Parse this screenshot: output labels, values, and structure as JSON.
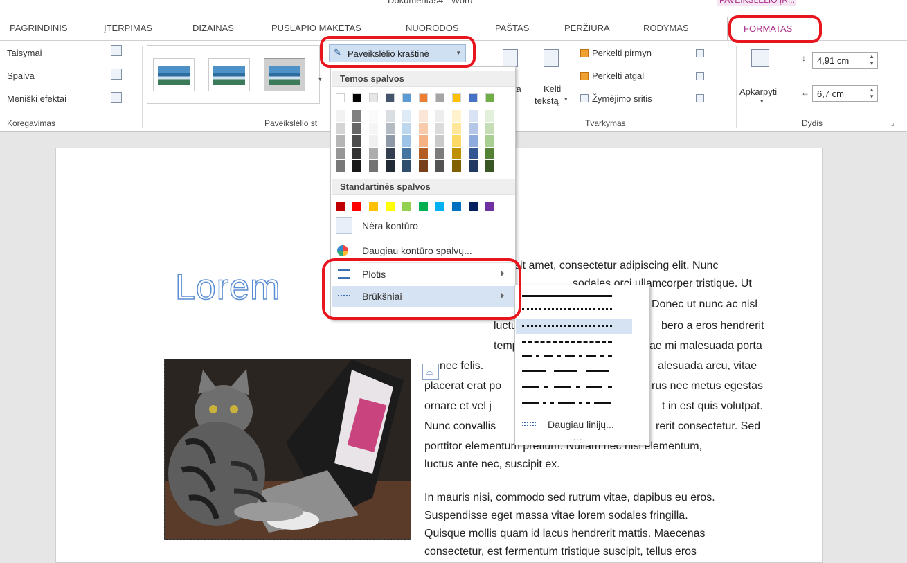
{
  "window": {
    "title": "Dokumentas4 - Word",
    "context_tab_group": "PAVEIKSLĖLIO ĮR..."
  },
  "tabs": [
    "PAGRINDINIS",
    "ĮTERPIMAS",
    "DIZAINAS",
    "PUSLAPIO MAKETAS",
    "NUORODOS",
    "PAŠTAS",
    "PERŽIŪRA",
    "RODYMAS",
    "FORMATAS"
  ],
  "ribbon": {
    "adjust": {
      "corrections": "Taisymai",
      "color": "Spalva",
      "artistic": "Meniški efektai",
      "group": "Koregavimas"
    },
    "picture_styles": {
      "border_button": "Paveikslėlio kraštinė",
      "group_partial": "Paveikslėlio st"
    },
    "arrange": {
      "position_partial": "ta",
      "wrap_line1": "Kelti",
      "wrap_line2": "tekstą",
      "bring_forward": "Perkelti pirmyn",
      "send_backward": "Perkelti atgal",
      "selection_pane": "Žymėjimo sritis",
      "group": "Tvarkymas"
    },
    "size": {
      "crop": "Apkarpyti",
      "height": "4,91 cm",
      "width": "6,7 cm",
      "group": "Dydis"
    }
  },
  "dropdown": {
    "theme_colors_header": "Temos spalvos",
    "standard_colors_header": "Standartinės spalvos",
    "no_outline": "Nėra kontūro",
    "more_colors": "Daugiau kontūro spalvų...",
    "weight": "Plotis",
    "dashes": "Brūkšniai",
    "theme_colors": [
      "#ffffff",
      "#000000",
      "#e7e6e6",
      "#44546a",
      "#5b9bd5",
      "#ed7d31",
      "#a5a5a5",
      "#ffc000",
      "#4472c4",
      "#70ad47"
    ],
    "standard_colors": [
      "#c00000",
      "#ff0000",
      "#ffc000",
      "#ffff00",
      "#92d050",
      "#00b050",
      "#00b0f0",
      "#0070c0",
      "#002060",
      "#7030a0"
    ]
  },
  "submenu": {
    "more_lines": "Daugiau linijų..."
  },
  "document": {
    "heading": "Lorem",
    "para1_lines": [
      "sit amet, consectetur adipiscing elit. Nunc",
      "sodales orci ullamcorper tristique. Ut",
      "Donec ut nunc ac nisl",
      "bero a eros hendrerit",
      "ae mi malesuada porta",
      "nec felis.",
      "alesuada arcu, vitae",
      "placerat erat po",
      "rus nec metus egestas",
      "ornare et vel j",
      "t in est quis volutpat.",
      "Nunc convallis",
      "rerit consectetur. Sed",
      "porttitor elementum pretium. Nullam nec nisl elementum,",
      "luctus ante nec, suscipit ex."
    ],
    "para1_fragments": [
      "luctu",
      "temp"
    ],
    "para2_lines": [
      "In mauris nisi, commodo sed rutrum vitae, dapibus eu eros.",
      "Suspendisse eget massa vitae lorem sodales fringilla.",
      "Quisque mollis quam id lacus hendrerit mattis. Maecenas",
      "consectetur, est fermentum tristique suscipit, tellus eros"
    ]
  },
  "accent_color": "#a8318b",
  "annotation_color": "#e8141e"
}
